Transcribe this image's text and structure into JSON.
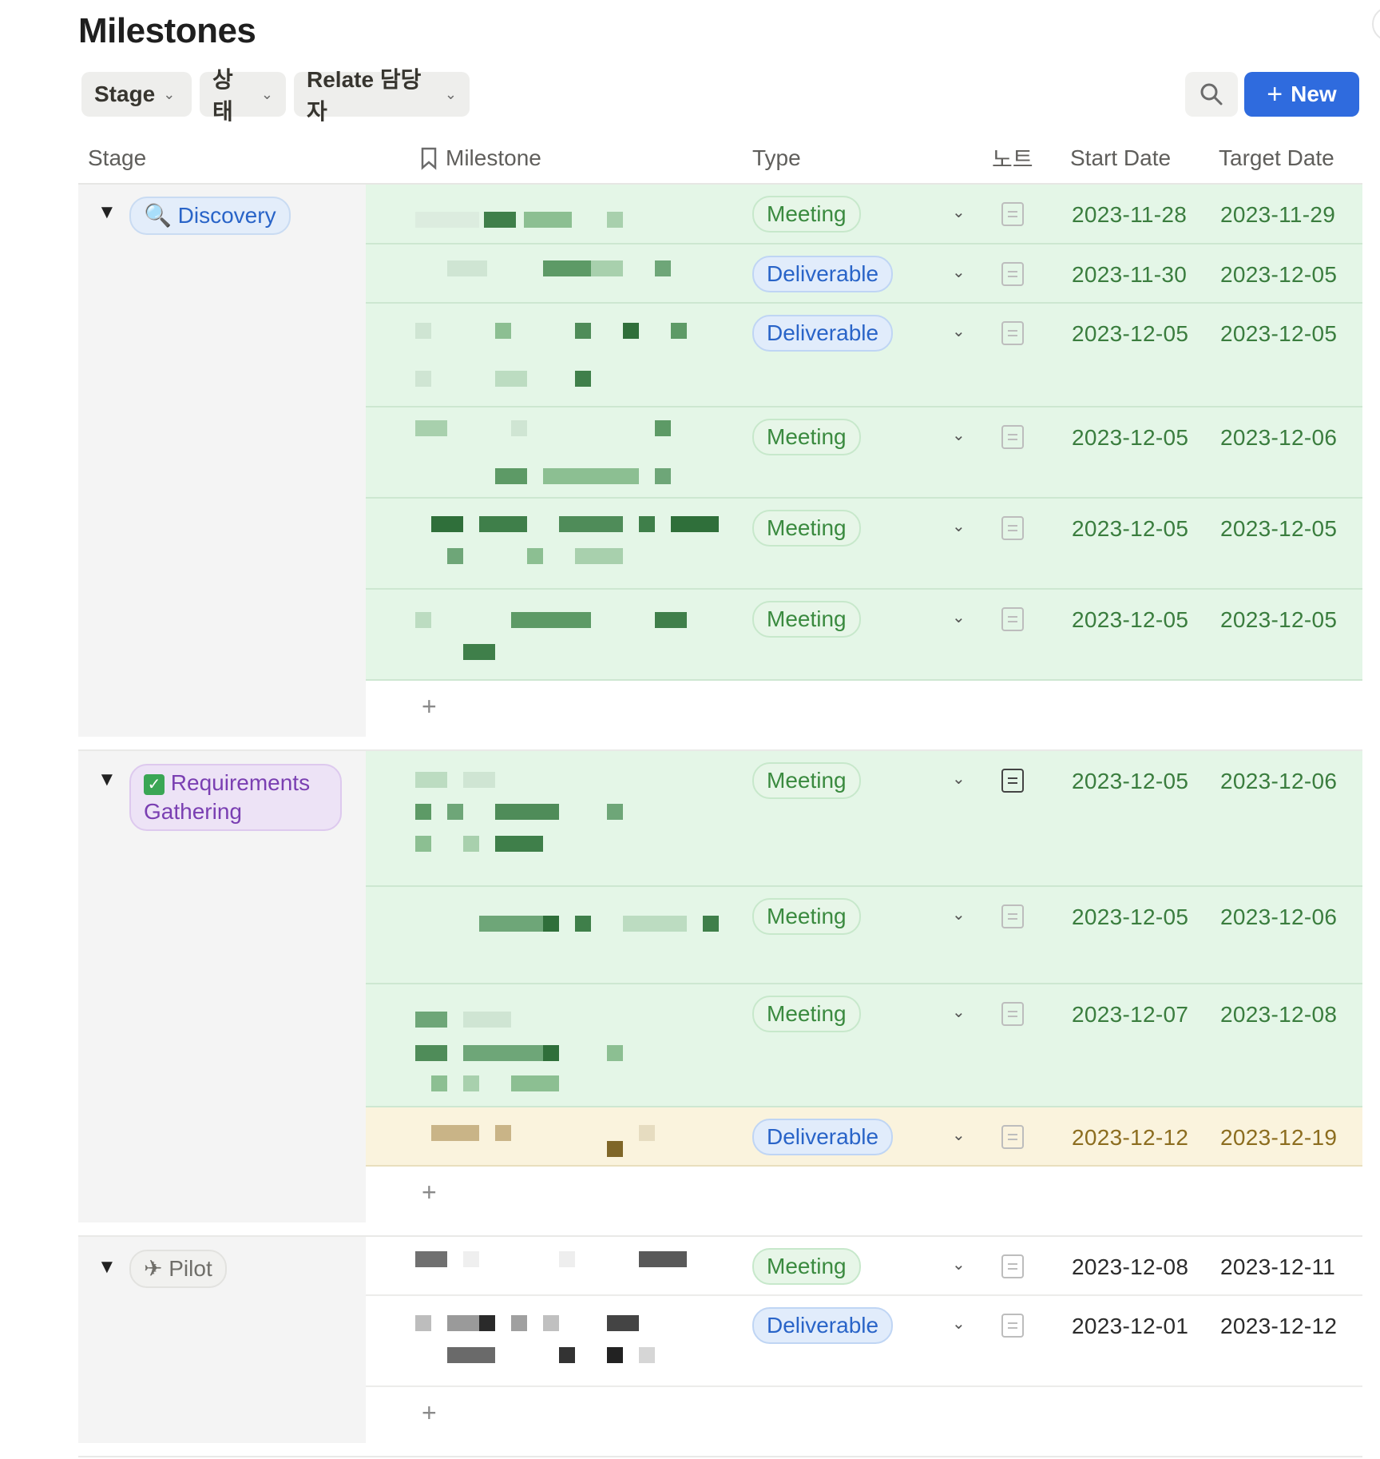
{
  "page_title": "Milestones",
  "filters": [
    "Stage",
    "상태",
    "Relate 담당자"
  ],
  "new_button_label": "New",
  "columns": {
    "stage": "Stage",
    "milestone": "Milestone",
    "type": "Type",
    "note": "노트",
    "start": "Start Date",
    "target": "Target Date"
  },
  "groups": [
    {
      "stage": "Discovery",
      "stage_icon": "magnifier-icon",
      "rows": [
        {
          "type": "Meeting",
          "start": "2023-11-28",
          "target": "2023-11-29",
          "highlight": "green"
        },
        {
          "type": "Deliverable",
          "start": "2023-11-30",
          "target": "2023-12-05",
          "highlight": "green"
        },
        {
          "type": "Deliverable",
          "start": "2023-12-05",
          "target": "2023-12-05",
          "highlight": "green"
        },
        {
          "type": "Meeting",
          "start": "2023-12-05",
          "target": "2023-12-06",
          "highlight": "green"
        },
        {
          "type": "Meeting",
          "start": "2023-12-05",
          "target": "2023-12-05",
          "highlight": "green"
        },
        {
          "type": "Meeting",
          "start": "2023-12-05",
          "target": "2023-12-05",
          "highlight": "green"
        }
      ]
    },
    {
      "stage_line1": "Requirements",
      "stage_line2": "Gathering",
      "stage_icon": "check-icon",
      "rows": [
        {
          "type": "Meeting",
          "start": "2023-12-05",
          "target": "2023-12-06",
          "highlight": "green"
        },
        {
          "type": "Meeting",
          "start": "2023-12-05",
          "target": "2023-12-06",
          "highlight": "green"
        },
        {
          "type": "Meeting",
          "start": "2023-12-07",
          "target": "2023-12-08",
          "highlight": "green"
        },
        {
          "type": "Deliverable",
          "start": "2023-12-12",
          "target": "2023-12-19",
          "highlight": "yellow"
        }
      ]
    },
    {
      "stage": "Pilot",
      "stage_icon": "airplane-icon",
      "rows": [
        {
          "type": "Meeting",
          "start": "2023-12-08",
          "target": "2023-12-11",
          "highlight": "none"
        },
        {
          "type": "Deliverable",
          "start": "2023-12-01",
          "target": "2023-12-12",
          "highlight": "none"
        }
      ]
    }
  ],
  "colors": {
    "accent": "#2f6bde",
    "row_green": "#e4f6e7",
    "row_yellow": "#faf3dd",
    "meeting": "#3a8a3f",
    "deliverable": "#2964c8"
  }
}
